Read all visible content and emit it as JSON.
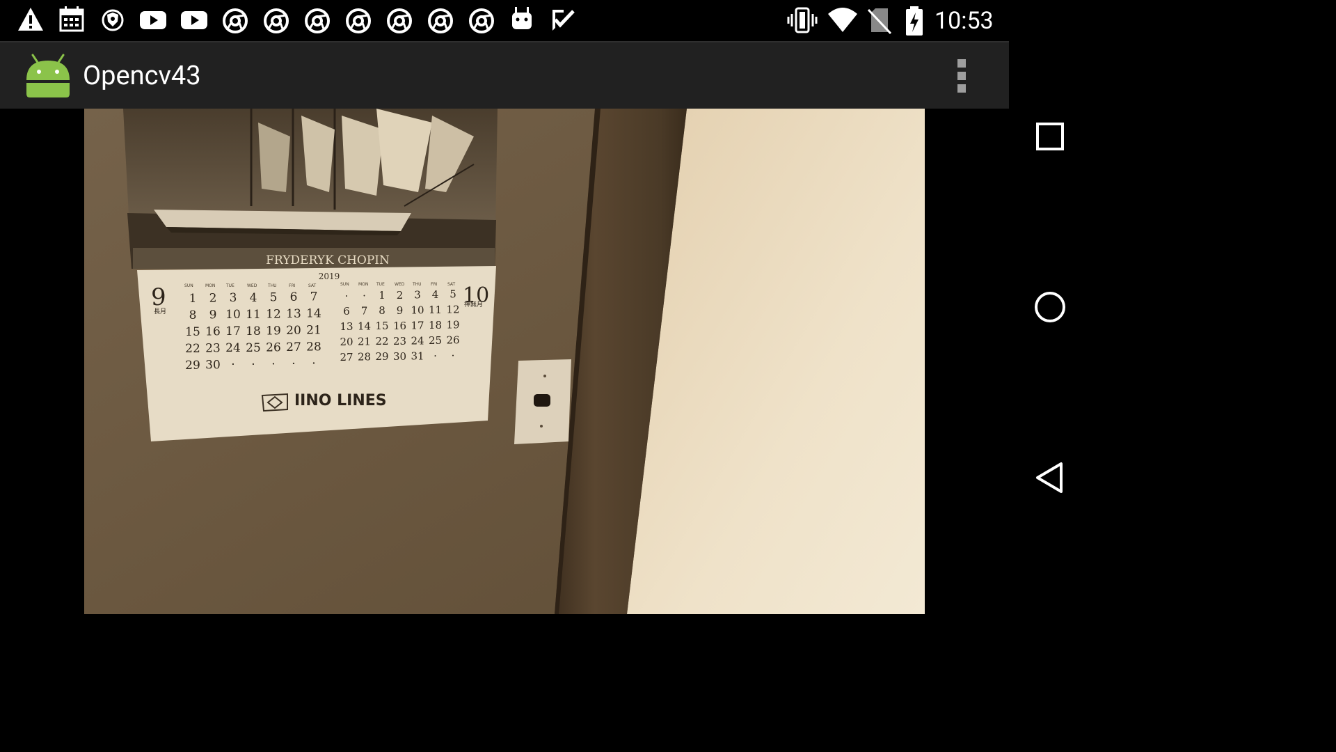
{
  "status_bar": {
    "clock": "10:53",
    "notification_icons": [
      "warning-icon",
      "calendar-icon",
      "brave-icon",
      "youtube-icon",
      "youtube-icon",
      "chrome-icon",
      "chrome-icon",
      "chrome-icon",
      "chrome-icon",
      "chrome-icon",
      "chrome-icon",
      "chrome-icon",
      "android-debug-icon",
      "task-check-icon"
    ],
    "system_icons": [
      "vibrate-icon",
      "wifi-icon",
      "no-sim-icon",
      "battery-charging-icon"
    ]
  },
  "app_bar": {
    "title": "Opencv43",
    "icon": "android-launcher-icon",
    "menu_icon": "overflow-menu-icon"
  },
  "camera": {
    "calendar": {
      "ship_name": "FRYDERYK CHOPIN",
      "year": "2019",
      "month_left": "9",
      "month_left_kanji": "長月",
      "month_right": "10",
      "month_right_kanji": "神無月",
      "weekdays": [
        "SUN",
        "MON",
        "TUE",
        "WED",
        "THU",
        "FRI",
        "SAT"
      ],
      "september": [
        [
          "1",
          "2",
          "3",
          "4",
          "5",
          "6",
          "7"
        ],
        [
          "8",
          "9",
          "10",
          "11",
          "12",
          "13",
          "14"
        ],
        [
          "15",
          "16",
          "17",
          "18",
          "19",
          "20",
          "21"
        ],
        [
          "22",
          "23",
          "24",
          "25",
          "26",
          "27",
          "28"
        ],
        [
          "29",
          "30",
          "·",
          "·",
          "·",
          "·",
          "·"
        ]
      ],
      "october": [
        [
          "·",
          "·",
          "1",
          "2",
          "3",
          "4",
          "5"
        ],
        [
          "6",
          "7",
          "8",
          "9",
          "10",
          "11",
          "12"
        ],
        [
          "13",
          "14",
          "15",
          "16",
          "17",
          "18",
          "19"
        ],
        [
          "20",
          "21",
          "22",
          "23",
          "24",
          "25",
          "26"
        ],
        [
          "27",
          "28",
          "29",
          "30",
          "31",
          "·",
          "·"
        ]
      ],
      "company": "IINO LINES"
    }
  },
  "nav_bar": {
    "buttons": [
      "recents-button",
      "home-button",
      "back-button"
    ]
  },
  "colors": {
    "app_bar": "#212121",
    "status_bar": "#000000",
    "sepia_wall": "#6e5a40",
    "sepia_door": "#ecdcc0"
  }
}
